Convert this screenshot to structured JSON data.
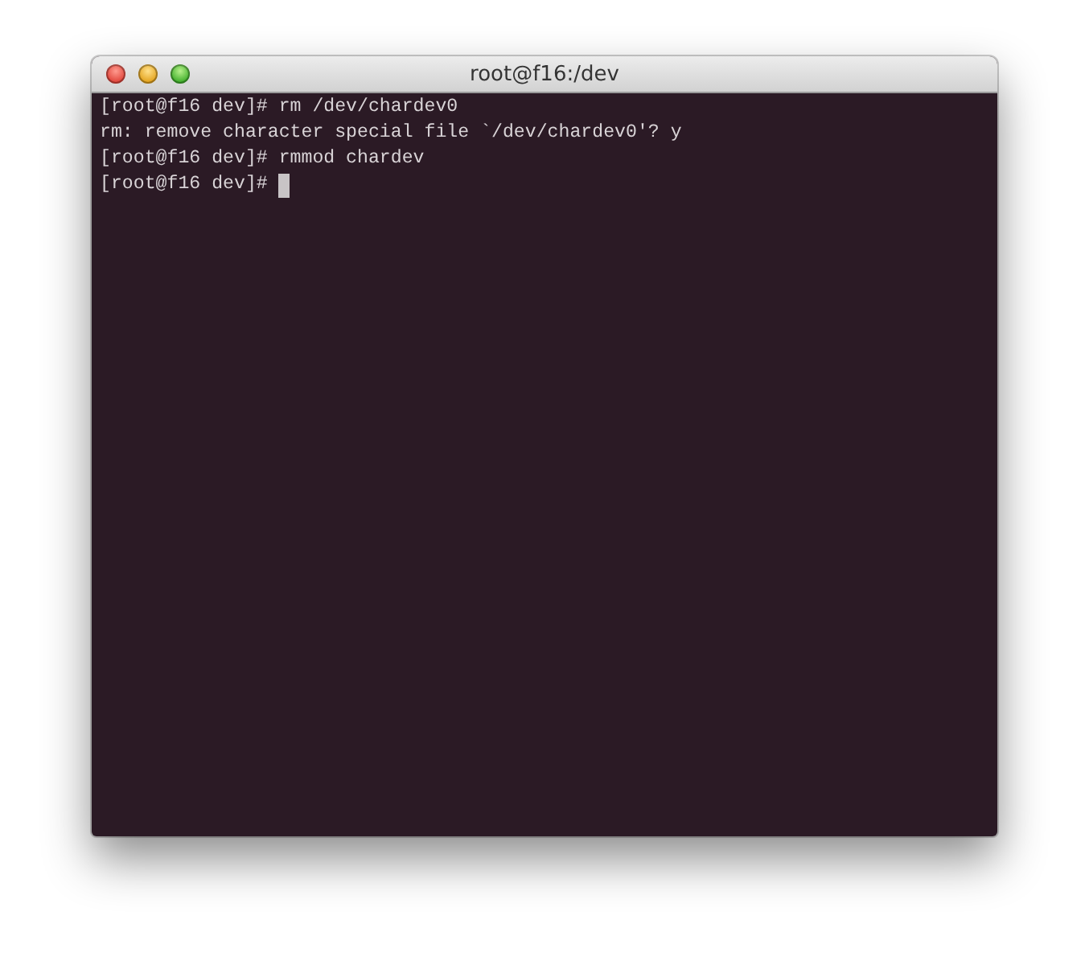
{
  "window": {
    "title": "root@f16:/dev"
  },
  "terminal": {
    "lines": [
      "[root@f16 dev]# rm /dev/chardev0",
      "rm: remove character special file `/dev/chardev0'? y",
      "[root@f16 dev]# rmmod chardev",
      "[root@f16 dev]# "
    ]
  }
}
